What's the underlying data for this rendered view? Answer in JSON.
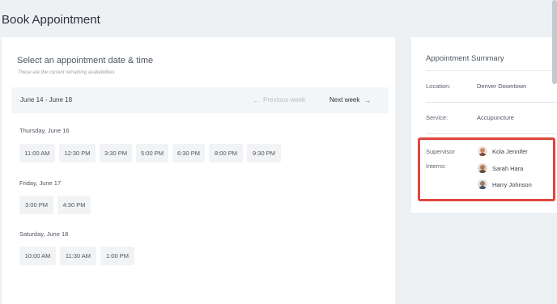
{
  "page": {
    "title": "Book Appointment"
  },
  "booking": {
    "heading": "Select an appointment date & time",
    "subheading": "These are the current remaining availabilities.",
    "week_range": "June 14 - June 18",
    "prev_week_label": "Previous week",
    "next_week_label": "Next week",
    "days": [
      {
        "label": "Thursday, June 16",
        "slots": [
          "11:00 AM",
          "12:30 PM",
          "3:30 PM",
          "5:00 PM",
          "6:30 PM",
          "8:00 PM",
          "9:30 PM"
        ]
      },
      {
        "label": "Friday, June 17",
        "slots": [
          "3:00 PM",
          "4:30 PM"
        ]
      },
      {
        "label": "Saturday, June 18",
        "slots": [
          "10:00 AM",
          "11:30 AM",
          "1:00 PM"
        ]
      }
    ]
  },
  "summary": {
    "title": "Appointment Summary",
    "location_label": "Location:",
    "location_value": "Denver Downtown",
    "service_label": "Service:",
    "service_value": "Accupuncture",
    "supervisor_label": "Supervisor",
    "interns_label": "Interns:",
    "staff": [
      {
        "name": "Kola Jennifer",
        "avatar": "female-avatar-icon"
      },
      {
        "name": "Sarah Hara",
        "avatar": "female-avatar-icon"
      },
      {
        "name": "Harry Johnson",
        "avatar": "male-avatar-icon"
      }
    ]
  },
  "colors": {
    "highlight": "#e0463c",
    "accent": "#2e8ae6"
  }
}
